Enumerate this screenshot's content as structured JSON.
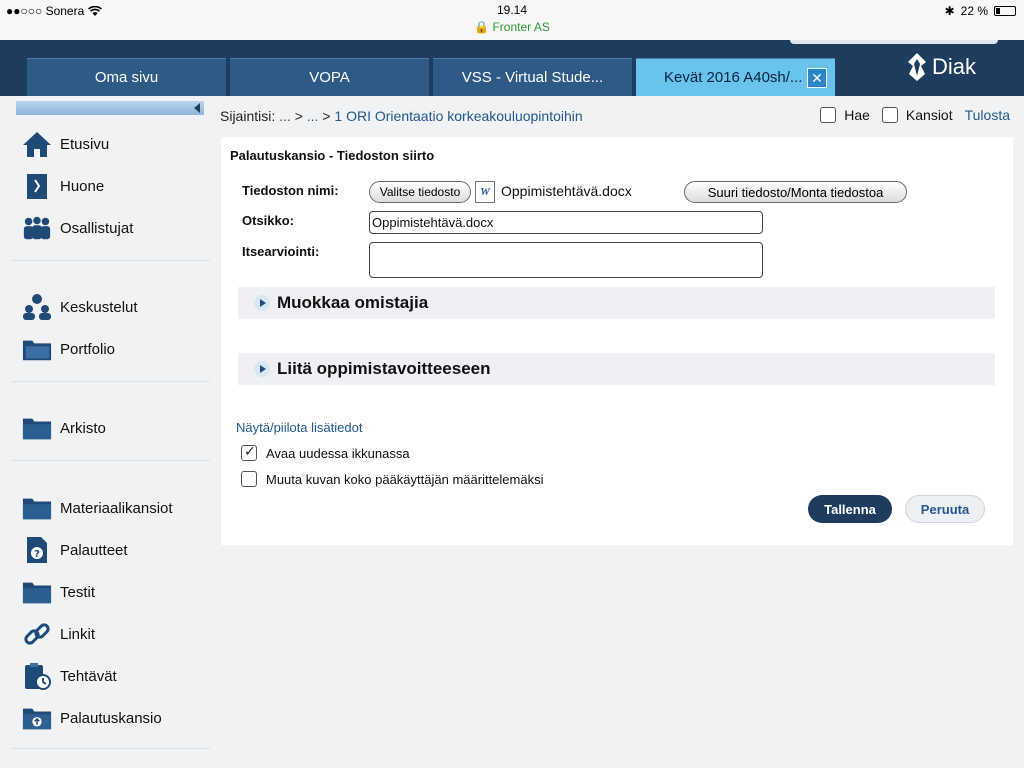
{
  "status_bar": {
    "carrier": "●●○○○ Sonera",
    "time": "19.14",
    "site": "Fronter AS",
    "battery": "22 %"
  },
  "tabs": [
    {
      "label": "Oma sivu"
    },
    {
      "label": "VOPA"
    },
    {
      "label": "VSS - Virtual Stude..."
    },
    {
      "label": "Kevät 2016 A40sh/..."
    }
  ],
  "logo": {
    "text": "Diak"
  },
  "sidebar": {
    "items": [
      {
        "label": "Etusivu",
        "icon": "home-icon"
      },
      {
        "label": "Huone",
        "icon": "room-door-icon"
      },
      {
        "label": "Osallistujat",
        "icon": "participants-icon"
      },
      {
        "label": "Keskustelut",
        "icon": "discussion-icon"
      },
      {
        "label": "Portfolio",
        "icon": "portfolio-folder-icon"
      },
      {
        "label": "Arkisto",
        "icon": "archive-folder-icon"
      },
      {
        "label": "Materiaalikansiot",
        "icon": "material-folder-icon"
      },
      {
        "label": "Palautteet",
        "icon": "feedback-icon"
      },
      {
        "label": "Testit",
        "icon": "test-folder-icon"
      },
      {
        "label": "Linkit",
        "icon": "link-icon"
      },
      {
        "label": "Tehtävät",
        "icon": "tasks-icon"
      },
      {
        "label": "Palautuskansio",
        "icon": "submission-folder-icon"
      }
    ]
  },
  "breadcrumb": {
    "prefix": "Sijaintisi:",
    "parts": [
      "...",
      "...",
      "1 ORI Orientaatio korkeakouluopintoihin"
    ]
  },
  "toolbar": {
    "search": "Hae",
    "folders": "Kansiot",
    "print": "Tulosta"
  },
  "form": {
    "title": "Palautuskansio - Tiedoston siirto",
    "filename_label": "Tiedoston nimi:",
    "choose_file": "Valitse tiedosto",
    "file_name": "Oppimistehtävä.docx",
    "large_file": "Suuri tiedosto/Monta tiedostoa",
    "title_label": "Otsikko:",
    "title_value": "Oppimistehtävä.docx",
    "self_eval_label": "Itsearviointi:",
    "self_eval_value": "",
    "section_owners": "Muokkaa omistajia",
    "section_goal": "Liitä oppimistavoitteeseen",
    "toggle_details": "Näytä/piilota lisätiedot",
    "open_new_window": "Avaa uudessa ikkunassa",
    "open_new_window_checked": true,
    "resize_image": "Muuta kuvan koko pääkäyttäjän määrittelemäksi",
    "resize_image_checked": false,
    "save": "Tallenna",
    "cancel": "Peruuta"
  },
  "colors": {
    "nav_bg": "#1d3c5e",
    "tab_bg": "#2d5b86",
    "tab_active": "#69c3ec",
    "link": "#24588f"
  }
}
